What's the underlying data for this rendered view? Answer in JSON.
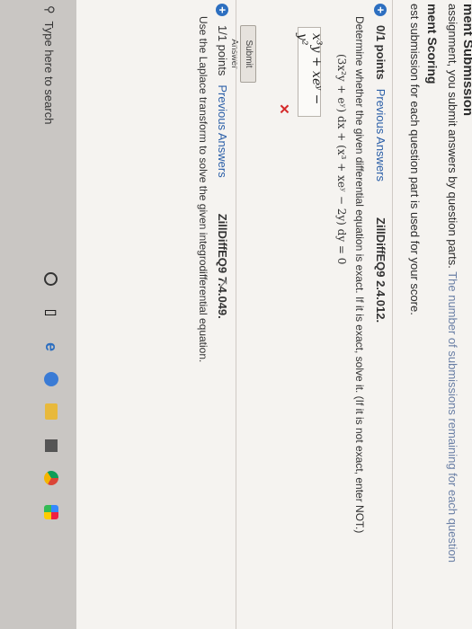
{
  "header": {
    "title": "ment Submission",
    "line1_a": "assignment, you submit answers by question parts.",
    "line1_b": "The number of submissions remaining for each question",
    "subtitle": "ment Scoring",
    "line3": "est submission for each question part is used for your score."
  },
  "question1": {
    "points": "0/1 points",
    "prev": "Previous Answers",
    "code": "ZillDiffEQ9 2.4.012.",
    "prompt": "Determine whether the given differential equation is exact. If it is exact, solve it. (If it is not exact, enter NOT.)",
    "equation": "(3x²y + eʸ) dx + (x³ + xeʸ − 2y) dy = 0",
    "answer": "x³y + xeʸ − y²",
    "status": "✕",
    "submit": "Submit Answer"
  },
  "question2": {
    "points": "1/1 points",
    "prev": "Previous Answers",
    "code": "ZillDiffEQ9 7.4.049.",
    "prompt": "Use the Laplace transform to solve the given integrodifferential equation."
  },
  "taskbar": {
    "search_placeholder": "Type here to search"
  },
  "icons": {
    "search": "search-icon",
    "plus": "plus-circle-icon",
    "wrong": "x-mark-icon"
  },
  "colors": {
    "accent": "#2d6fc0",
    "error": "#d52b2b"
  }
}
